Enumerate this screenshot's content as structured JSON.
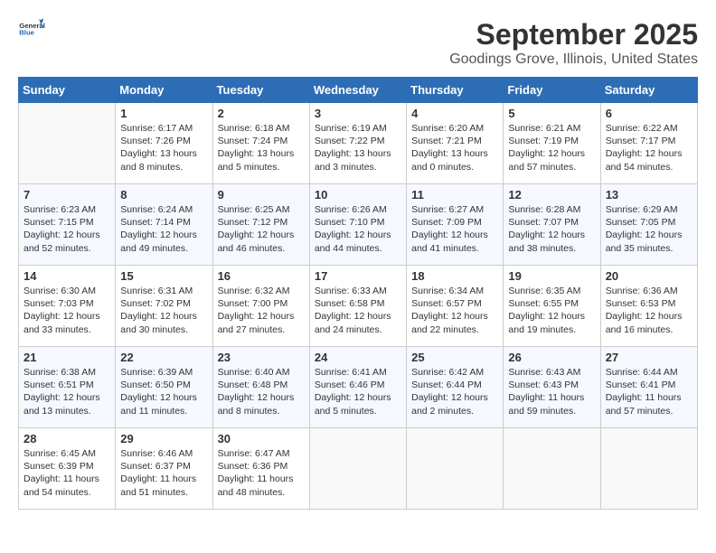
{
  "header": {
    "logo_general": "General",
    "logo_blue": "Blue",
    "month": "September 2025",
    "location": "Goodings Grove, Illinois, United States"
  },
  "weekdays": [
    "Sunday",
    "Monday",
    "Tuesday",
    "Wednesday",
    "Thursday",
    "Friday",
    "Saturday"
  ],
  "weeks": [
    [
      {
        "day": "",
        "info": ""
      },
      {
        "day": "1",
        "info": "Sunrise: 6:17 AM\nSunset: 7:26 PM\nDaylight: 13 hours\nand 8 minutes."
      },
      {
        "day": "2",
        "info": "Sunrise: 6:18 AM\nSunset: 7:24 PM\nDaylight: 13 hours\nand 5 minutes."
      },
      {
        "day": "3",
        "info": "Sunrise: 6:19 AM\nSunset: 7:22 PM\nDaylight: 13 hours\nand 3 minutes."
      },
      {
        "day": "4",
        "info": "Sunrise: 6:20 AM\nSunset: 7:21 PM\nDaylight: 13 hours\nand 0 minutes."
      },
      {
        "day": "5",
        "info": "Sunrise: 6:21 AM\nSunset: 7:19 PM\nDaylight: 12 hours\nand 57 minutes."
      },
      {
        "day": "6",
        "info": "Sunrise: 6:22 AM\nSunset: 7:17 PM\nDaylight: 12 hours\nand 54 minutes."
      }
    ],
    [
      {
        "day": "7",
        "info": "Sunrise: 6:23 AM\nSunset: 7:15 PM\nDaylight: 12 hours\nand 52 minutes."
      },
      {
        "day": "8",
        "info": "Sunrise: 6:24 AM\nSunset: 7:14 PM\nDaylight: 12 hours\nand 49 minutes."
      },
      {
        "day": "9",
        "info": "Sunrise: 6:25 AM\nSunset: 7:12 PM\nDaylight: 12 hours\nand 46 minutes."
      },
      {
        "day": "10",
        "info": "Sunrise: 6:26 AM\nSunset: 7:10 PM\nDaylight: 12 hours\nand 44 minutes."
      },
      {
        "day": "11",
        "info": "Sunrise: 6:27 AM\nSunset: 7:09 PM\nDaylight: 12 hours\nand 41 minutes."
      },
      {
        "day": "12",
        "info": "Sunrise: 6:28 AM\nSunset: 7:07 PM\nDaylight: 12 hours\nand 38 minutes."
      },
      {
        "day": "13",
        "info": "Sunrise: 6:29 AM\nSunset: 7:05 PM\nDaylight: 12 hours\nand 35 minutes."
      }
    ],
    [
      {
        "day": "14",
        "info": "Sunrise: 6:30 AM\nSunset: 7:03 PM\nDaylight: 12 hours\nand 33 minutes."
      },
      {
        "day": "15",
        "info": "Sunrise: 6:31 AM\nSunset: 7:02 PM\nDaylight: 12 hours\nand 30 minutes."
      },
      {
        "day": "16",
        "info": "Sunrise: 6:32 AM\nSunset: 7:00 PM\nDaylight: 12 hours\nand 27 minutes."
      },
      {
        "day": "17",
        "info": "Sunrise: 6:33 AM\nSunset: 6:58 PM\nDaylight: 12 hours\nand 24 minutes."
      },
      {
        "day": "18",
        "info": "Sunrise: 6:34 AM\nSunset: 6:57 PM\nDaylight: 12 hours\nand 22 minutes."
      },
      {
        "day": "19",
        "info": "Sunrise: 6:35 AM\nSunset: 6:55 PM\nDaylight: 12 hours\nand 19 minutes."
      },
      {
        "day": "20",
        "info": "Sunrise: 6:36 AM\nSunset: 6:53 PM\nDaylight: 12 hours\nand 16 minutes."
      }
    ],
    [
      {
        "day": "21",
        "info": "Sunrise: 6:38 AM\nSunset: 6:51 PM\nDaylight: 12 hours\nand 13 minutes."
      },
      {
        "day": "22",
        "info": "Sunrise: 6:39 AM\nSunset: 6:50 PM\nDaylight: 12 hours\nand 11 minutes."
      },
      {
        "day": "23",
        "info": "Sunrise: 6:40 AM\nSunset: 6:48 PM\nDaylight: 12 hours\nand 8 minutes."
      },
      {
        "day": "24",
        "info": "Sunrise: 6:41 AM\nSunset: 6:46 PM\nDaylight: 12 hours\nand 5 minutes."
      },
      {
        "day": "25",
        "info": "Sunrise: 6:42 AM\nSunset: 6:44 PM\nDaylight: 12 hours\nand 2 minutes."
      },
      {
        "day": "26",
        "info": "Sunrise: 6:43 AM\nSunset: 6:43 PM\nDaylight: 11 hours\nand 59 minutes."
      },
      {
        "day": "27",
        "info": "Sunrise: 6:44 AM\nSunset: 6:41 PM\nDaylight: 11 hours\nand 57 minutes."
      }
    ],
    [
      {
        "day": "28",
        "info": "Sunrise: 6:45 AM\nSunset: 6:39 PM\nDaylight: 11 hours\nand 54 minutes."
      },
      {
        "day": "29",
        "info": "Sunrise: 6:46 AM\nSunset: 6:37 PM\nDaylight: 11 hours\nand 51 minutes."
      },
      {
        "day": "30",
        "info": "Sunrise: 6:47 AM\nSunset: 6:36 PM\nDaylight: 11 hours\nand 48 minutes."
      },
      {
        "day": "",
        "info": ""
      },
      {
        "day": "",
        "info": ""
      },
      {
        "day": "",
        "info": ""
      },
      {
        "day": "",
        "info": ""
      }
    ]
  ]
}
